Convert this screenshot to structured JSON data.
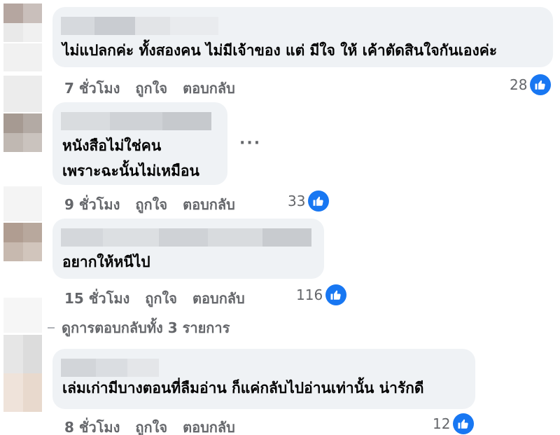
{
  "comments": [
    {
      "text": "ไม่แปลกค่ะ ทั้งสองคน ไม่มีเจ้าของ แต่ มีใจ ให้ เค้าตัดสินใจกันเองค่ะ",
      "time": "7 ชั่วโมง",
      "like_label": "ถูกใจ",
      "reply_label": "ตอบกลับ",
      "likes": "28",
      "avatar_colors": [
        "#b5a6a0",
        "#c9bfbb",
        "#e9e9e9",
        "#f0f0f0"
      ]
    },
    {
      "text": "หนังสือไม่ใช่คน\nเพราะฉะนั้นไม่เหมือน",
      "time": "9 ชั่วโมง",
      "like_label": "ถูกใจ",
      "reply_label": "ตอบกลับ",
      "likes": "33",
      "more": "···",
      "avatar_colors": [
        "#a69a92",
        "#b3aaa4",
        "#c0b8b2",
        "#cac3be"
      ]
    },
    {
      "text": "อยากให้หนีไป",
      "time": "15 ชั่วโมง",
      "like_label": "ถูกใจ",
      "reply_label": "ตอบกลับ",
      "likes": "116",
      "avatar_colors": [
        "#b09d91",
        "#b8a89d",
        "#c7b9af",
        "#d1c5bc"
      ]
    },
    {
      "text": "เล่มเก่ามีบางตอนที่ลืมอ่าน ก็แค่กลับไปอ่านเท่านั้น น่ารักดี",
      "time": "8 ชั่วโมง",
      "like_label": "ถูกใจ",
      "reply_label": "ตอบกลับ",
      "likes": "12",
      "avatar_colors": [
        "#e6e6e6",
        "#dcdcdc",
        "#efe3da",
        "#e8d9cd"
      ]
    }
  ],
  "view_replies": "ดูการตอบกลับทั้ง 3 รายการ",
  "colors": {
    "bubble": "#eff2f5",
    "meta_text": "#65676b",
    "like_blue": "#1877f2"
  }
}
